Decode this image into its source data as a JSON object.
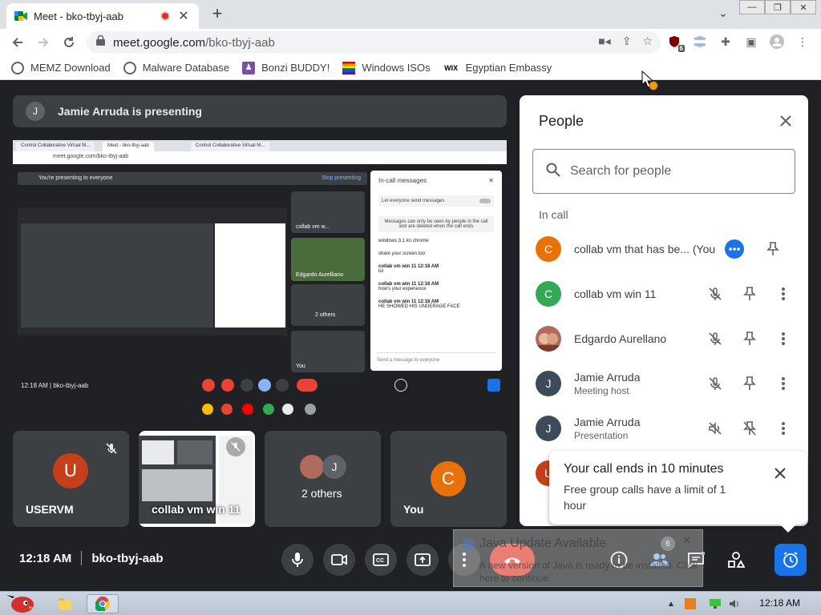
{
  "browser": {
    "tab_title": "Meet - bko-tbyj-aab",
    "url_host": "meet.google.com",
    "url_path": "/bko-tbyj-aab",
    "extension_badge": "6"
  },
  "bookmarks": [
    {
      "label": "MEMZ Download"
    },
    {
      "label": "Malware Database"
    },
    {
      "label": "Bonzi BUDDY!"
    },
    {
      "label": "Windows ISOs"
    },
    {
      "label": "Egyptian Embassy"
    }
  ],
  "meet": {
    "presenting_avatar": "J",
    "presenting_text": "Jamie Arruda is presenting",
    "time": "12:18 AM",
    "meeting_code": "bko-tbyj-aab",
    "people_badge": "6",
    "shared_screen": {
      "tabs": [
        "Control Collaborative Virtual M...",
        "Meet - bko-tbyj-aab",
        "Control Collaborative Virtual M..."
      ],
      "url": "meet.google.com/bko-tbyj-aab",
      "presenting_notice": "You're presenting to everyone",
      "stop_presenting": "Stop presenting",
      "time": "12:18 AM  |  bko-tbyj-aab",
      "chat": {
        "title": "In-call messages",
        "toggle": "Let everyone send messages",
        "note": "Messages can only be seen by people in the call and are deleted when the call ends",
        "messages": [
          {
            "author": "",
            "text": "windows 3.1 kn chrome"
          },
          {
            "author": "",
            "text": "share your screen too"
          },
          {
            "author": "collab vm win 11  12:18 AM",
            "text": "lol"
          },
          {
            "author": "collab vm win 11  12:18 AM",
            "text": "how's your experience"
          },
          {
            "author": "collab vm win 11  12:18 AM",
            "text": "HE SHOWED HIS UNDERAGE FACE"
          }
        ],
        "input_placeholder": "Send a message to everyone"
      },
      "side_tiles": [
        "collab vm w...",
        "Edgardo Aurelliano",
        "2 others",
        "You"
      ]
    },
    "tiles": [
      {
        "name": "USERVM",
        "avatar": "U",
        "color": "#c5401a"
      },
      {
        "name": "collab vm win 11",
        "avatar": "",
        "color": ""
      },
      {
        "name": "2 others",
        "avatar": "J",
        "color": "#5f6368"
      },
      {
        "name": "You",
        "avatar": "C",
        "color": "#e8710a"
      }
    ]
  },
  "people_panel": {
    "title": "People",
    "search_placeholder": "Search for people",
    "section_label": "In call",
    "people": [
      {
        "avatar": "C",
        "color": "#e8710a",
        "name": "collab vm that has be...  (You)",
        "sub": ""
      },
      {
        "avatar": "C",
        "color": "#34a853",
        "name": "collab vm win 11",
        "sub": ""
      },
      {
        "avatar": "",
        "color": "#b06b5c",
        "name": "Edgardo Aurellano",
        "sub": ""
      },
      {
        "avatar": "J",
        "color": "#3c4a5a",
        "name": "Jamie Arruda",
        "sub": "Meeting host"
      },
      {
        "avatar": "J",
        "color": "#3c4a5a",
        "name": "Jamie Arruda",
        "sub": "Presentation"
      },
      {
        "avatar": "U",
        "color": "#c5401a",
        "name": "",
        "sub": ""
      }
    ]
  },
  "toast": {
    "title": "Your call ends in 10 minutes",
    "body": "Free group calls have a limit of 1 hour"
  },
  "java_popup": {
    "title": "Java Update Available",
    "body": "A new version of Java is ready to be installed. Click here to continue."
  },
  "taskbar": {
    "time": "12:18 AM"
  }
}
